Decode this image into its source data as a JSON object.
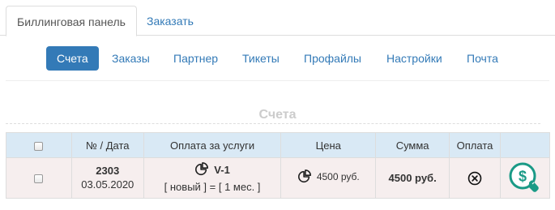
{
  "top_tabs": [
    "Биллинговая панель",
    "Заказать"
  ],
  "subnav": [
    "Счета",
    "Заказы",
    "Партнер",
    "Тикеты",
    "Профайлы",
    "Настройки",
    "Почта"
  ],
  "section_title": "Счета",
  "table": {
    "headers": [
      "",
      "№ / Дата",
      "Оплата за услуги",
      "Цена",
      "Сумма",
      "Оплата",
      ""
    ],
    "rows": [
      {
        "number": "2303",
        "date": "03.05.2020",
        "service_name": "V-1",
        "service_details": "[ новый ] = [ 1 мес. ]",
        "price": "4500 руб.",
        "sum": "4500 руб.",
        "payment_icon": "x-circle-icon",
        "action_icon": "pay-dollar-icon"
      }
    ]
  },
  "colors": {
    "accent": "#337ab7",
    "header_bg": "#d9e9f5",
    "row_bg": "#f6eeee",
    "pay_icon_green": "#1a9a86"
  }
}
